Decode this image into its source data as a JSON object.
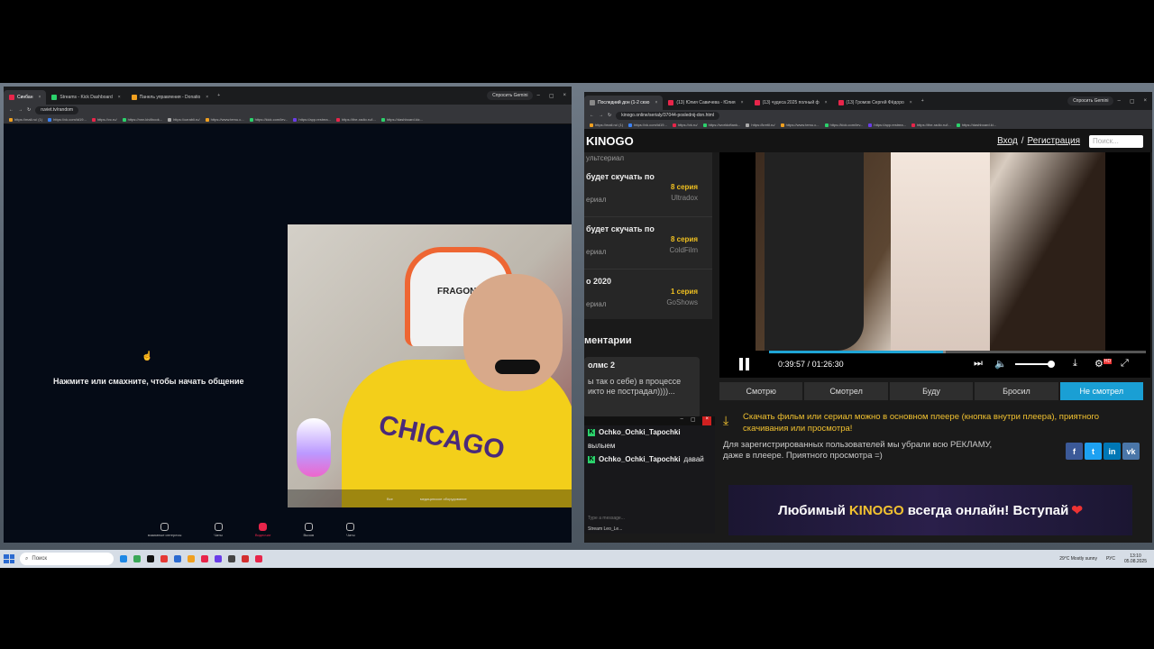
{
  "left_window": {
    "tabs": [
      {
        "label": "Синбан",
        "color": "#e8254a",
        "active": true
      },
      {
        "label": "Streams - Kick Dashboard",
        "color": "#2bd16b",
        "active": false
      },
      {
        "label": "Панель управления - Donatio",
        "color": "#f0a020",
        "active": false
      }
    ],
    "gemini_label": "Спросить Gemini",
    "url": "ruviet.tv/random",
    "bookmarks": [
      "https://mail.ru/ (1)",
      "https://vk.com/id19...",
      "https://vc.ru/",
      "https://nnn.kivilbook...",
      "https://ozrabli.ru/",
      "https://www.temu.c...",
      "https://kick.com/lev...",
      "https://app.restrea...",
      "https://the-radio.ru/i...",
      "https://dashboard.kic..."
    ],
    "hint": "Нажмите или смахните, чтобы начать общение",
    "cam_footer": [
      "Все",
      "медицинское оборудование"
    ],
    "chair_brand": "FRAGON",
    "jersey_text": "CHICAGO",
    "nav": [
      {
        "label": "взаимные интересы",
        "live": false
      },
      {
        "label": "Чаты",
        "live": false
      },
      {
        "label": "Видеочат",
        "live": true
      },
      {
        "label": "Вызов",
        "live": false
      },
      {
        "label": "Чаты",
        "live": false
      }
    ]
  },
  "right_window": {
    "tabs": [
      {
        "label": "Последний дон (1-2 сезо",
        "color": "#888888",
        "active": true
      },
      {
        "label": "(13) Юлия Савичева - Юлия",
        "color": "#e8254a",
        "active": false
      },
      {
        "label": "(13) чудеса 2025 полный ф",
        "color": "#e8254a",
        "active": false
      },
      {
        "label": "(13) Громов Сергей Фёдоро",
        "color": "#e8254a",
        "active": false
      }
    ],
    "gemini_label": "Спросить Gemini",
    "url": "kinogo.online/serialy/37044-poslednij-don.html",
    "bookmarks": [
      "https://mail.ru/ (1)",
      "https://vk.com/id19...",
      "https://vk.ru/",
      "https://worldoftank...",
      "https://kretil.ru/",
      "https://www.temu.c...",
      "https://kick.com/lev...",
      "https://app.restrea...",
      "https://the-radio.ru/i...",
      "https://dashboard.ki..."
    ],
    "site": {
      "logo": "KINOGO",
      "login": "Вход",
      "sep": "/",
      "register": "Регистрация",
      "search_placeholder": "Поиск...",
      "list": [
        {
          "title": "будет скучать по",
          "sub": "ериал",
          "episode": "8 серия",
          "source": "Ultradox"
        },
        {
          "title": "будет скучать по",
          "sub": "ериал",
          "episode": "8 серия",
          "source": "ColdFilm"
        },
        {
          "title": "о   2020",
          "sub": "ериал",
          "episode": "1 серия",
          "source": "GoShows"
        }
      ],
      "list_top": "ультсериал",
      "comments_heading": "ментарии",
      "comment": {
        "name": "олмс 2",
        "body": "ы так о себе) в процессе икто не пострадал))))..."
      },
      "player": {
        "current": "0:39:57",
        "sep": "/",
        "duration": "01:26:30",
        "progress": 0.462,
        "buffered": 0.47,
        "volume": 0.85,
        "hd_badge": "HD"
      },
      "status_buttons": [
        {
          "label": "Смотрю",
          "active": false
        },
        {
          "label": "Смотрел",
          "active": false
        },
        {
          "label": "Буду",
          "active": false
        },
        {
          "label": "Бросил",
          "active": false
        },
        {
          "label": "Не смотрел",
          "active": true
        }
      ],
      "download_note": "Скачать фильм или сериал можно в основном плеере (кнопка внутри плеера), приятного скачивания или просмотра!",
      "reg_note": "Для зарегистрированных пользователей мы убрали всю РЕКЛАМУ, даже в плеере. Приятного просмотра =)",
      "social": [
        {
          "name": "f",
          "color": "#3b5998"
        },
        {
          "name": "t",
          "color": "#1da1f2"
        },
        {
          "name": "in",
          "color": "#0077b5"
        },
        {
          "name": "vk",
          "color": "#4a76a8"
        }
      ],
      "banner_pre": "Любимый",
      "banner_brand": "KINOGO",
      "banner_post": "всегда онлайн! Вступай",
      "banner_heart": "❤"
    },
    "chat": {
      "messages": [
        {
          "user": "Ochko_Ochki_Tapochki",
          "text": ""
        },
        {
          "user": "",
          "text": "вылыем"
        },
        {
          "user": "Ochko_Ochki_Tapochki",
          "text": "давай"
        }
      ],
      "input_placeholder": "Type a message...",
      "footer": "Stream Leo_Le..."
    }
  },
  "taskbar": {
    "search": "Поиск",
    "weather": "29°C  Mostly sunny",
    "lang": "РУС",
    "time": "13:10",
    "date": "05.08.2025",
    "apps": [
      "#1e88e5",
      "#3aa757",
      "#111111",
      "#e53935",
      "#2b6ad0",
      "#f0a020",
      "#e8254a",
      "#6a3de8",
      "#444444",
      "#d32f2f",
      "#e8254a"
    ]
  }
}
